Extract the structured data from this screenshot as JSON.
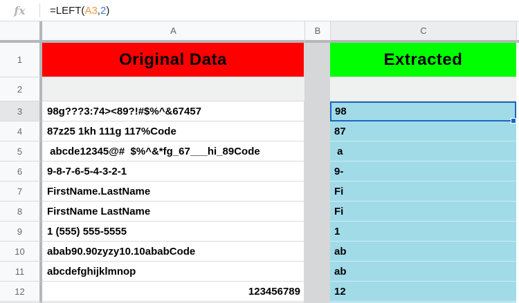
{
  "formula_bar": {
    "fx_label": "fx",
    "formula_full": "=LEFT(A3,2)",
    "tokens": {
      "prefix": "=LEFT(",
      "ref": "A3",
      "separator": ",",
      "argument": "2",
      "suffix": ")"
    },
    "token_colors": {
      "default": "#1b1b1b",
      "ref": "#f0993c",
      "argument": "#3d7bd9"
    }
  },
  "grid": {
    "col_headers": {
      "a": "A",
      "b": "B",
      "c": "C"
    },
    "row1": {
      "num": "1",
      "a_label": "Original Data",
      "c_label": "Extracted"
    },
    "row2": {
      "num": "2"
    },
    "data_rows": [
      {
        "num": "3",
        "a": "98g???3:74><89?!#$%^&67457",
        "c": "98",
        "selected": true
      },
      {
        "num": "4",
        "a": "87z25 1kh 111g 117%Code",
        "c": "87"
      },
      {
        "num": "5",
        "a": " abcde12345@#  $%^&*fg_67___hi_89Code",
        "c": " a"
      },
      {
        "num": "6",
        "a": "9-8-7-6-5-4-3-2-1",
        "c": "9-"
      },
      {
        "num": "7",
        "a": "FirstName.LastName",
        "c": "Fi"
      },
      {
        "num": "8",
        "a": "FirstName LastName",
        "c": "Fi"
      },
      {
        "num": "9",
        "a": "1 (555) 555-5555",
        "c": "1"
      },
      {
        "num": "10",
        "a": "abab90.90zyzy10.10ababCode",
        "c": "ab"
      },
      {
        "num": "11",
        "a": "abcdefghijklmnop",
        "c": "ab"
      },
      {
        "num": "12",
        "a": "123456789",
        "c": "12",
        "a_align": "right"
      }
    ],
    "selected_cell": "C3"
  },
  "colors": {
    "original_header_bg": "#fe0000",
    "extracted_header_bg": "#00ff00",
    "extracted_column_bg": "#a2dbe8",
    "column_b_bg": "#d6d7d8",
    "row2_bg": "#eff0f0",
    "selection_border": "#1766c2",
    "header_bg": "#f8f9fa",
    "thick_border": "#b4b7ba"
  }
}
